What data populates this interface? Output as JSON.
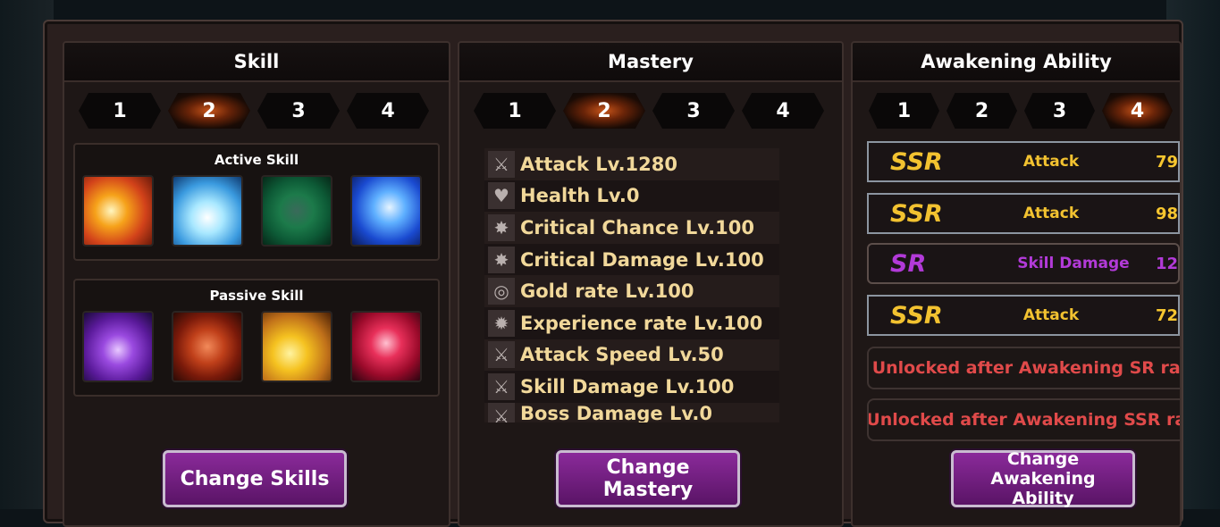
{
  "skill": {
    "title": "Skill",
    "tabs": [
      "1",
      "2",
      "3",
      "4"
    ],
    "active_tab": 1,
    "active_label": "Active Skill",
    "passive_label": "Passive Skill",
    "button": "Change Skills"
  },
  "mastery": {
    "title": "Mastery",
    "tabs": [
      "1",
      "2",
      "3",
      "4"
    ],
    "active_tab": 1,
    "items": [
      {
        "icon": "crossed-swords-icon",
        "text": "Attack Lv.1280"
      },
      {
        "icon": "heart-icon",
        "text": "Health Lv.0"
      },
      {
        "icon": "burst-icon",
        "text": "Critical Chance Lv.100"
      },
      {
        "icon": "burst-icon",
        "text": "Critical Damage Lv.100"
      },
      {
        "icon": "coin-icon",
        "text": "Gold rate Lv.100"
      },
      {
        "icon": "gear-icon",
        "text": "Experience rate Lv.100"
      },
      {
        "icon": "crossed-swords-icon",
        "text": "Attack Speed Lv.50"
      },
      {
        "icon": "crossed-swords-icon",
        "text": "Skill Damage Lv.100"
      },
      {
        "icon": "crossed-swords-icon",
        "text": "Boss Damage Lv.0"
      }
    ],
    "button": "Change Mastery"
  },
  "awakening": {
    "title": "Awakening Ability",
    "tabs": [
      "1",
      "2",
      "3",
      "4"
    ],
    "active_tab": 3,
    "rows": [
      {
        "grade": "SSR",
        "stat": "Attack",
        "value": "79",
        "color": "#f2c230"
      },
      {
        "grade": "SSR",
        "stat": "Attack",
        "value": "98",
        "color": "#f2c230"
      },
      {
        "grade": "SR",
        "stat": "Skill Damage",
        "value": "12",
        "color": "#b23ad8"
      },
      {
        "grade": "SSR",
        "stat": "Attack",
        "value": "72",
        "color": "#f2c230"
      }
    ],
    "locked": [
      "Unlocked after Awakening SR ran",
      "Unlocked after Awakening SSR ran"
    ],
    "button_line1": "Change Awakening",
    "button_line2": "Ability"
  }
}
